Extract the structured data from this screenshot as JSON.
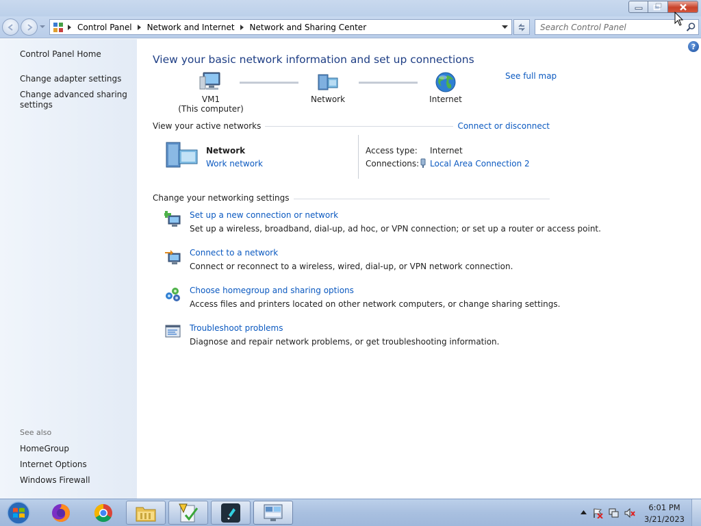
{
  "window": {
    "buttons": {
      "minimize": "minimize",
      "restore": "restore",
      "close": "close"
    }
  },
  "address_bar": {
    "breadcrumbs": [
      "Control Panel",
      "Network and Internet",
      "Network and Sharing Center"
    ]
  },
  "search": {
    "placeholder": "Search Control Panel"
  },
  "sidebar": {
    "home": "Control Panel Home",
    "links": [
      "Change adapter settings",
      "Change advanced sharing settings"
    ],
    "see_also_label": "See also",
    "see_also": [
      "HomeGroup",
      "Internet Options",
      "Windows Firewall"
    ]
  },
  "main": {
    "title": "View your basic network information and set up connections",
    "map": {
      "computer_name": "VM1",
      "computer_sub": "(This computer)",
      "network": "Network",
      "internet": "Internet",
      "see_full_map": "See full map"
    },
    "active_networks": {
      "heading": "View your active networks",
      "connect_link": "Connect or disconnect",
      "network_name": "Network",
      "network_type": "Work network",
      "access_type_label": "Access type:",
      "access_type_value": "Internet",
      "connections_label": "Connections:",
      "connections_value": "Local Area Connection 2"
    },
    "settings": {
      "heading": "Change your networking settings",
      "tasks": [
        {
          "title": "Set up a new connection or network",
          "desc": "Set up a wireless, broadband, dial-up, ad hoc, or VPN connection; or set up a router or access point."
        },
        {
          "title": "Connect to a network",
          "desc": "Connect or reconnect to a wireless, wired, dial-up, or VPN network connection."
        },
        {
          "title": "Choose homegroup and sharing options",
          "desc": "Access files and printers located on other network computers, or change sharing settings."
        },
        {
          "title": "Troubleshoot problems",
          "desc": "Diagnose and repair network problems, or get troubleshooting information."
        }
      ]
    }
  },
  "taskbar": {
    "clock_time": "6:01 PM",
    "clock_date": "3/21/2023"
  },
  "colors": {
    "link": "#0b59c0",
    "title": "#1d3d84",
    "sidebar_bg": "#e9f0f9"
  }
}
